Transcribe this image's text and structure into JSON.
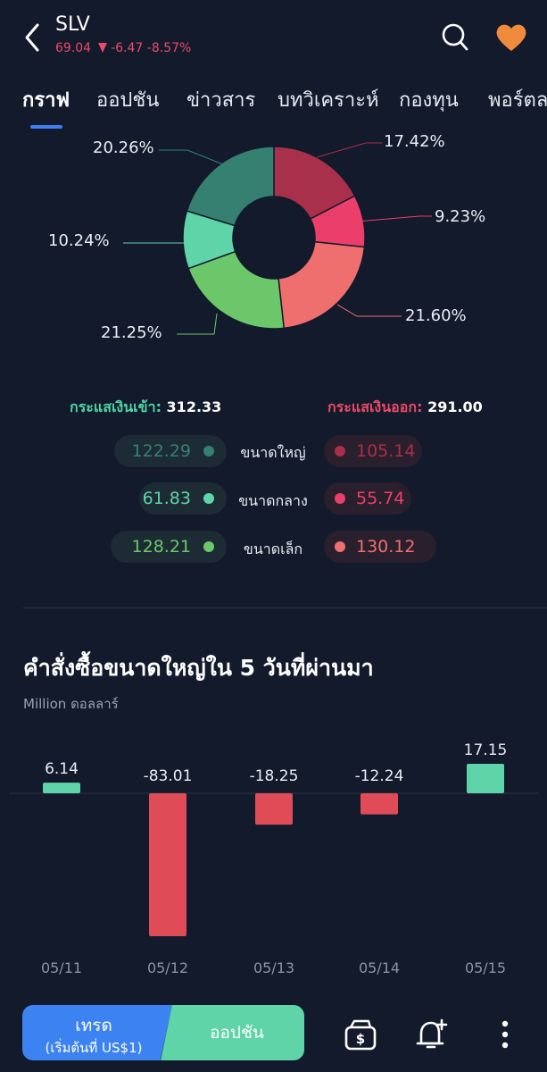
{
  "header": {
    "ticker": "SLV",
    "price": "69.04",
    "change": "-6.47",
    "change_pct": "-8.57%",
    "icons": {
      "back": "back-chevron-icon",
      "search": "search-icon",
      "favorite": "heart-icon"
    },
    "colors": {
      "down": "#ec4a67",
      "favorite": "#f08a3c"
    }
  },
  "tabs": [
    {
      "label": "กราฟ",
      "active": true
    },
    {
      "label": "ออปชัน"
    },
    {
      "label": "ข่าวสาร"
    },
    {
      "label": "บทวิเคราะห์"
    },
    {
      "label": "กองทุน"
    },
    {
      "label": "พอร์ตล"
    }
  ],
  "donut": {
    "segments": [
      {
        "label": "17.42%",
        "value": 17.42,
        "color": "#a8304a"
      },
      {
        "label": "9.23%",
        "value": 9.23,
        "color": "#ec3e6b"
      },
      {
        "label": "21.60%",
        "value": 21.6,
        "color": "#ef6f6f"
      },
      {
        "label": "21.25%",
        "value": 21.25,
        "color": "#6cc76a"
      },
      {
        "label": "10.24%",
        "value": 10.24,
        "color": "#5fd4a8"
      },
      {
        "label": "20.26%",
        "value": 20.26,
        "color": "#358070"
      }
    ]
  },
  "flows": {
    "inflow_label": "กระแสเงินเข้า:",
    "inflow_value": "312.33",
    "outflow_label": "กระแสเงินออก:",
    "outflow_value": "291.00",
    "rows": [
      {
        "size": "ขนาดใหญ่",
        "in": "122.29",
        "out": "105.14",
        "in_color": "#358070",
        "out_color": "#a8304a"
      },
      {
        "size": "ขนาดกลาง",
        "in": "61.83",
        "out": "55.74",
        "in_color": "#5fd4a8",
        "out_color": "#ec3e6b"
      },
      {
        "size": "ขนาดเล็ก",
        "in": "128.21",
        "out": "130.12",
        "in_color": "#6cc76a",
        "out_color": "#ef6f6f"
      }
    ]
  },
  "large_orders": {
    "title": "คำสั่งซื้อขนาดใหญ่ใน 5 วันที่ผ่านมา",
    "unit": "Million ดอลลาร์"
  },
  "chart_data": {
    "type": "bar",
    "categories": [
      "05/11",
      "05/12",
      "05/13",
      "05/14",
      "05/15"
    ],
    "values": [
      6.14,
      -83.01,
      -18.25,
      -12.24,
      17.15
    ],
    "value_labels": [
      "6.14",
      "-83.01",
      "-18.25",
      "-12.24",
      "17.15"
    ],
    "colors": {
      "positive": "#5fd4a8",
      "negative": "#e04b58"
    }
  },
  "bottom_bar": {
    "trade_label": "เทรด",
    "trade_sub": "(เริ่มต้นที่ US$1)",
    "option_label": "ออปชัน",
    "icons": {
      "wallet": "wallet-icon",
      "alert": "bell-plus-icon",
      "more": "more-vertical-icon"
    }
  }
}
